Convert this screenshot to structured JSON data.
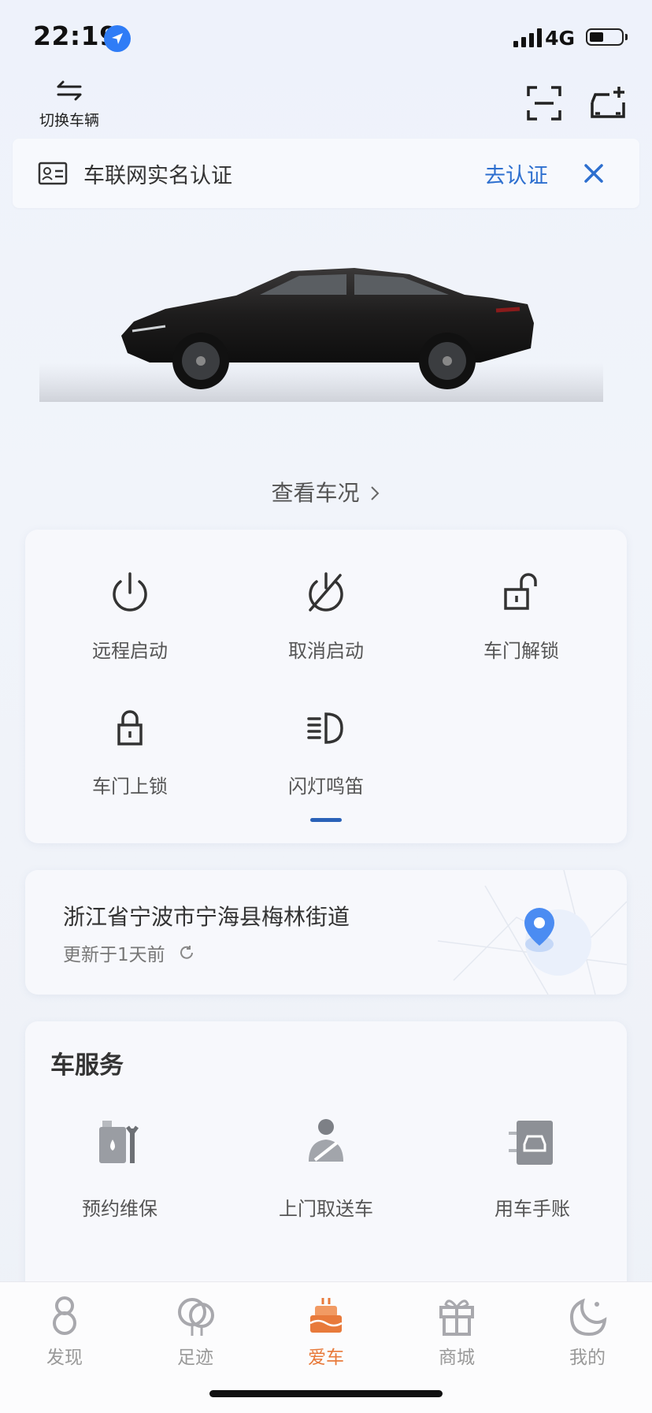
{
  "status_bar": {
    "time": "22:19",
    "network": "4G"
  },
  "header": {
    "switch_label": "切换车辆",
    "scan_icon": "scan-icon",
    "add_vehicle_icon": "add-vehicle-icon"
  },
  "banner": {
    "title": "车联网实名认证",
    "action": "去认证"
  },
  "vehicle": {
    "check_status": "查看车况"
  },
  "controls": [
    {
      "label": "远程启动",
      "icon": "power-icon"
    },
    {
      "label": "取消启动",
      "icon": "power-off-icon"
    },
    {
      "label": "车门解锁",
      "icon": "unlock-icon"
    },
    {
      "label": "车门上锁",
      "icon": "lock-icon"
    },
    {
      "label": "闪灯鸣笛",
      "icon": "headlight-icon"
    }
  ],
  "location": {
    "address": "浙江省宁波市宁海县梅林街道",
    "updated": "更新于1天前"
  },
  "services": {
    "title": "车服务",
    "items": [
      {
        "label": "预约维保",
        "icon": "maintenance-icon"
      },
      {
        "label": "上门取送车",
        "icon": "valet-icon"
      },
      {
        "label": "用车手账",
        "icon": "car-manual-icon"
      }
    ]
  },
  "tabbar": {
    "active": "爱车",
    "items": [
      {
        "label": "发现",
        "icon": "discover-icon"
      },
      {
        "label": "足迹",
        "icon": "footprint-icon"
      },
      {
        "label": "爱车",
        "icon": "my-car-icon"
      },
      {
        "label": "商城",
        "icon": "mall-icon"
      },
      {
        "label": "我的",
        "icon": "profile-icon"
      }
    ]
  },
  "colors": {
    "accent_blue": "#2d6fcf",
    "active_tab": "#e87a3b",
    "pager": "#2a62b8"
  }
}
